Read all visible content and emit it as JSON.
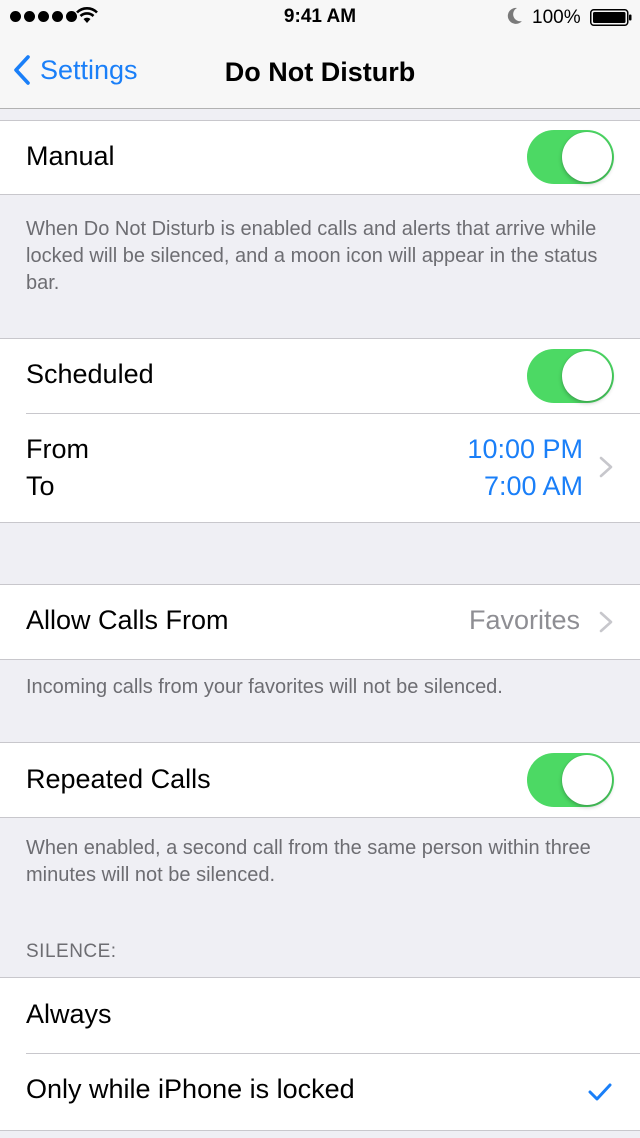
{
  "status_bar": {
    "time": "9:41 AM",
    "battery": "100%",
    "icons": [
      "signal-dots",
      "wifi-icon",
      "moon-icon",
      "battery-icon"
    ]
  },
  "nav": {
    "back_label": "Settings",
    "title": "Do Not Disturb"
  },
  "manual": {
    "label": "Manual",
    "toggle_on": true,
    "footer": "When Do Not Disturb is enabled calls and alerts that arrive while locked will be silenced, and a moon icon will appear in the status bar."
  },
  "scheduled": {
    "label": "Scheduled",
    "toggle_on": true,
    "from_label": "From",
    "to_label": "To",
    "from_value": "10:00 PM",
    "to_value": "7:00 AM"
  },
  "allow_calls": {
    "label": "Allow Calls From",
    "value": "Favorites",
    "footer": "Incoming calls from your favorites will not be silenced."
  },
  "repeated_calls": {
    "label": "Repeated Calls",
    "toggle_on": true,
    "footer": "When enabled, a second call from the same person within three minutes will not be silenced."
  },
  "silence": {
    "header": "SILENCE:",
    "options": [
      "Always",
      "Only while iPhone is locked"
    ],
    "selected_index": 1
  },
  "colors": {
    "accent": "#1a7ff8",
    "toggle_on": "#4cd964",
    "background": "#efeff4",
    "secondary_text": "#6d6d72"
  }
}
